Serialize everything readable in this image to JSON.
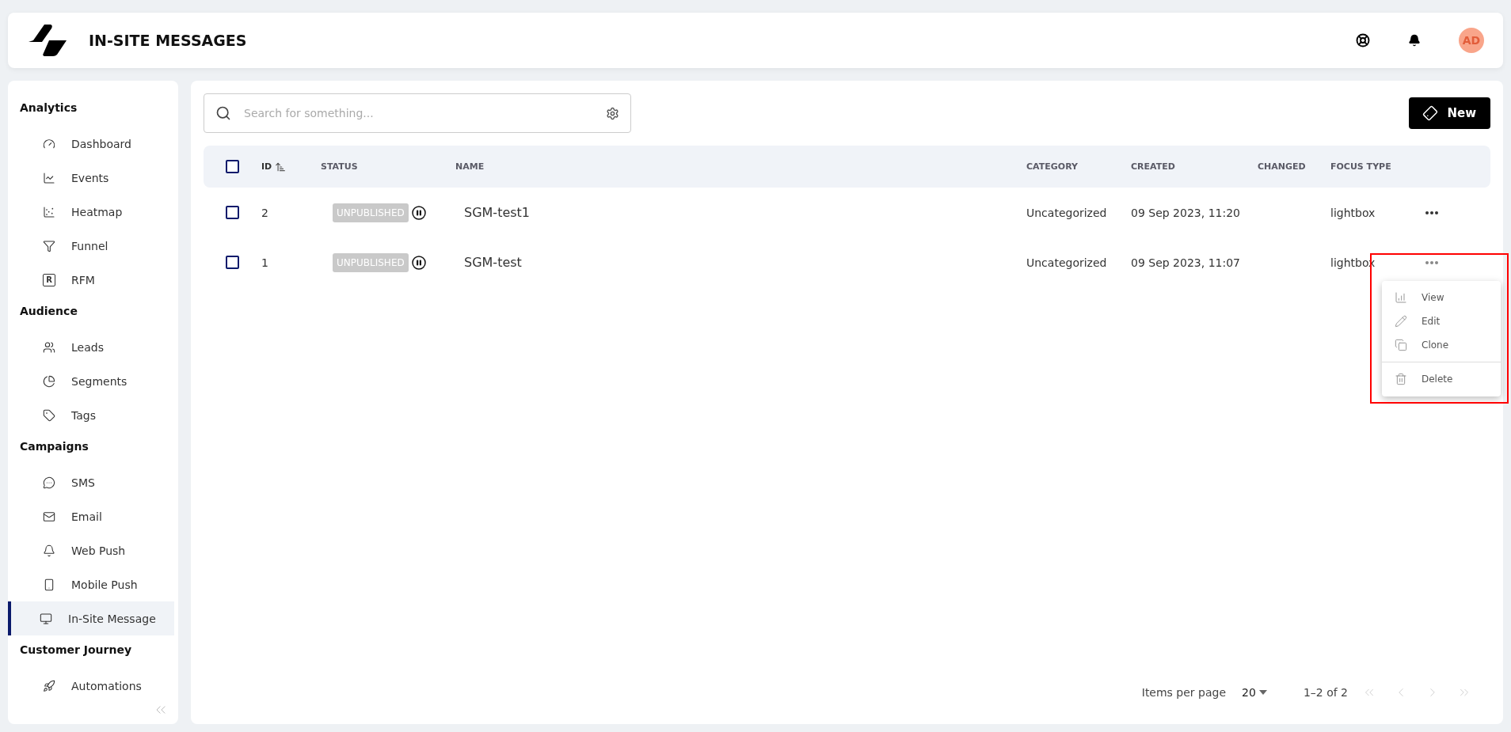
{
  "header": {
    "title": "IN-SITE MESSAGES",
    "avatar": "AD"
  },
  "sidebar": {
    "sections": [
      {
        "title": "Analytics",
        "items": [
          {
            "label": "Dashboard",
            "selected": false
          },
          {
            "label": "Events",
            "selected": false
          },
          {
            "label": "Heatmap",
            "selected": false
          },
          {
            "label": "Funnel",
            "selected": false
          },
          {
            "label": "RFM",
            "selected": false,
            "letter": "R"
          }
        ]
      },
      {
        "title": "Audience",
        "items": [
          {
            "label": "Leads",
            "selected": false
          },
          {
            "label": "Segments",
            "selected": false
          },
          {
            "label": "Tags",
            "selected": false
          }
        ]
      },
      {
        "title": "Campaigns",
        "items": [
          {
            "label": "SMS",
            "selected": false
          },
          {
            "label": "Email",
            "selected": false
          },
          {
            "label": "Web Push",
            "selected": false
          },
          {
            "label": "Mobile Push",
            "selected": false
          },
          {
            "label": "In-Site Message",
            "selected": true
          }
        ]
      },
      {
        "title": "Customer Journey",
        "items": [
          {
            "label": "Automations",
            "selected": false
          }
        ]
      }
    ]
  },
  "search": {
    "placeholder": "Search for something..."
  },
  "new_button": "New",
  "table": {
    "header_checked": false,
    "columns": [
      {
        "label": "ID",
        "sorted": true
      },
      {
        "label": "STATUS",
        "sorted": false
      },
      {
        "label": "NAME",
        "sorted": false
      },
      {
        "label": "CATEGORY",
        "sorted": false
      },
      {
        "label": "CREATED",
        "sorted": false
      },
      {
        "label": "CHANGED",
        "sorted": false
      },
      {
        "label": "FOCUS TYPE",
        "sorted": false
      }
    ],
    "rows": [
      {
        "checked": false,
        "id": "2",
        "status": "UNPUBLISHED",
        "name": "SGM-test1",
        "category": "Uncategorized",
        "created": "09 Sep 2023, 11:20",
        "focus_type": "lightbox",
        "menu_open": false
      },
      {
        "checked": false,
        "id": "1",
        "status": "UNPUBLISHED",
        "name": "SGM-test",
        "category": "Uncategorized",
        "created": "09 Sep 2023, 11:07",
        "focus_type": "lightbox",
        "menu_open": true
      }
    ]
  },
  "row_menu": {
    "highlighted": true,
    "items": [
      {
        "label": "View",
        "divider_before": false
      },
      {
        "label": "Edit",
        "divider_before": false
      },
      {
        "label": "Clone",
        "divider_before": false
      },
      {
        "label": "Delete",
        "divider_before": true
      }
    ]
  },
  "pagination": {
    "items_per_page_label": "Items per page",
    "page_size": "20",
    "range": "1–2 of 2",
    "buttons": [
      {
        "disabled": true
      },
      {
        "disabled": true
      },
      {
        "disabled": true
      },
      {
        "disabled": true
      }
    ]
  }
}
